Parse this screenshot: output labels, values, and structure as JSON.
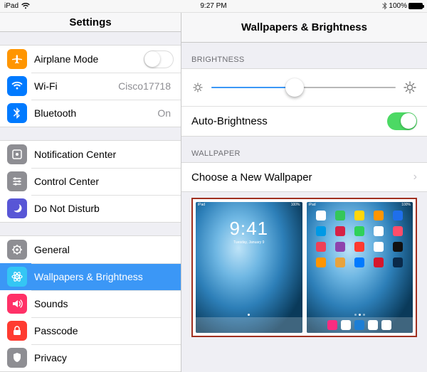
{
  "statusbar": {
    "device": "iPad",
    "time": "9:27 PM",
    "battery": "100%"
  },
  "left": {
    "title": "Settings",
    "g1": {
      "airplane": {
        "label": "Airplane Mode"
      },
      "wifi": {
        "label": "Wi-Fi",
        "value": "Cisco17718"
      },
      "bluetooth": {
        "label": "Bluetooth",
        "value": "On"
      }
    },
    "g2": {
      "nc": {
        "label": "Notification Center"
      },
      "cc": {
        "label": "Control Center"
      },
      "dnd": {
        "label": "Do Not Disturb"
      }
    },
    "g3": {
      "general": {
        "label": "General"
      },
      "wb": {
        "label": "Wallpapers & Brightness"
      },
      "sounds": {
        "label": "Sounds"
      },
      "passcode": {
        "label": "Passcode"
      },
      "privacy": {
        "label": "Privacy"
      }
    }
  },
  "right": {
    "title": "Wallpapers & Brightness",
    "brightness_hdr": "BRIGHTNESS",
    "auto_label": "Auto-Brightness",
    "wallpaper_hdr": "WALLPAPER",
    "choose_label": "Choose a New Wallpaper",
    "slider_pct": 45,
    "lock_preview": {
      "time": "9:41",
      "date": "Tuesday, January 9"
    }
  },
  "colors": {
    "orange": "#ff9500",
    "blue": "#007aff",
    "grey": "#8e8e93",
    "red": "#ff3b30",
    "darkred": "#c7252e",
    "purple": "#5856d6",
    "highlight": "#3b97f6",
    "cyan": "#34c6f4"
  }
}
